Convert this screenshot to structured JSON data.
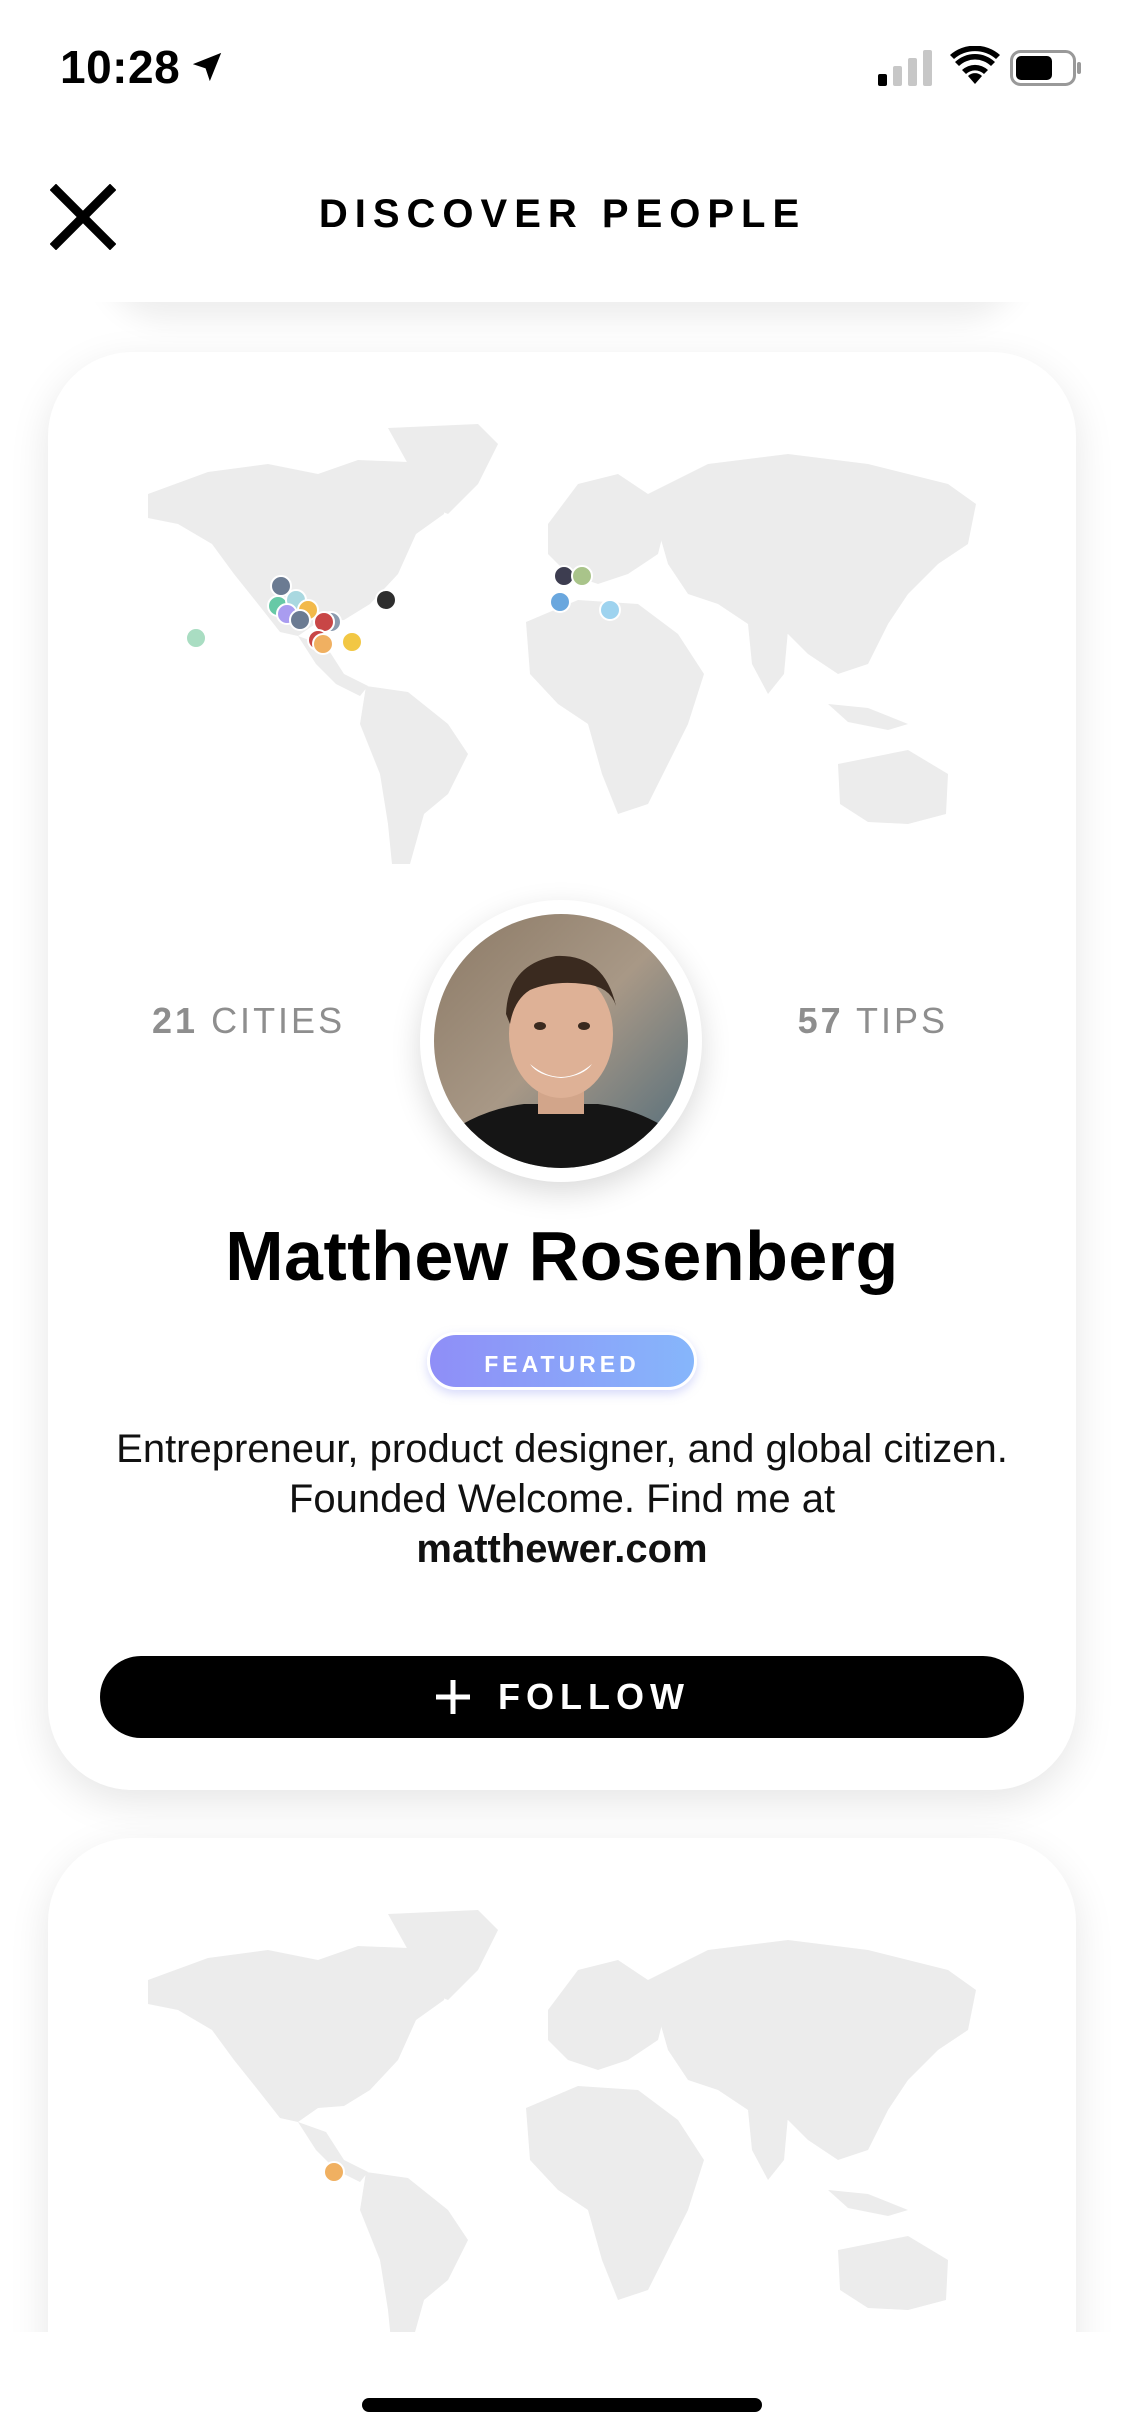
{
  "status_bar": {
    "time": "10:28",
    "icons": [
      "location-arrow-icon",
      "cellular-signal-icon",
      "wifi-icon",
      "battery-icon"
    ]
  },
  "header": {
    "title": "DISCOVER PEOPLE",
    "close_icon": "close-icon"
  },
  "profile": {
    "cities_count": "21",
    "cities_label": "CITIES",
    "tips_count": "57",
    "tips_label": "TIPS",
    "name": "Matthew Rosenberg",
    "badge": "FEATURED",
    "bio": "Entrepreneur, product designer, and global citizen. Founded Welcome. Find me at",
    "bio_link": "matthewer.com",
    "follow_label": "FOLLOW",
    "follow_icon": "plus-icon"
  },
  "colors": {
    "badge_gradient_start": "#8f8ef7",
    "badge_gradient_end": "#86b6fb",
    "button_bg": "#000000",
    "map_land": "#ececec",
    "stat_text": "#8e8e8e"
  }
}
